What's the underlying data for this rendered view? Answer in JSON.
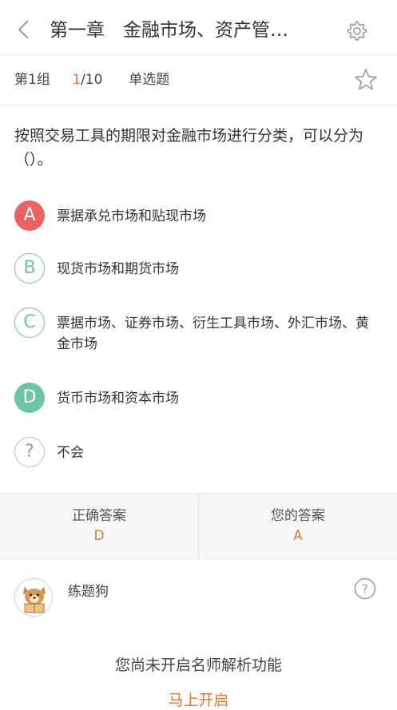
{
  "header": {
    "title": "第一章　金融市场、资产管…",
    "back_icon": "chevron-left-icon",
    "settings_icon": "gear-icon"
  },
  "meta": {
    "group": "第1组",
    "current": "1",
    "total": "/10",
    "type": "单选题",
    "favorite_icon": "star-icon"
  },
  "question": {
    "text": "按照交易工具的期限对金融市场进行分类，可以分为（）。"
  },
  "options": [
    {
      "letter": "A",
      "text": "票据承兑市场和贴现市场",
      "state": "wrong"
    },
    {
      "letter": "B",
      "text": "现货市场和期货市场",
      "state": "normal"
    },
    {
      "letter": "C",
      "text": "票据市场、证券市场、衍生工具市场、外汇市场、黄金市场",
      "state": "normal"
    },
    {
      "letter": "D",
      "text": "货币市场和资本市场",
      "state": "correct"
    },
    {
      "letter": "?",
      "text": "不会",
      "state": "unknown"
    }
  ],
  "answers": {
    "correct_label": "正确答案",
    "correct_value": "D",
    "yours_label": "您的答案",
    "yours_value": "A"
  },
  "explanation": {
    "username": "练题狗",
    "help_icon": "question-circle-icon",
    "notice": "您尚未开启名师解析功能",
    "open_label": "马上开启"
  },
  "colors": {
    "accent": "#e8752c",
    "correct": "#6cc4a4",
    "wrong": "#ec6263"
  }
}
